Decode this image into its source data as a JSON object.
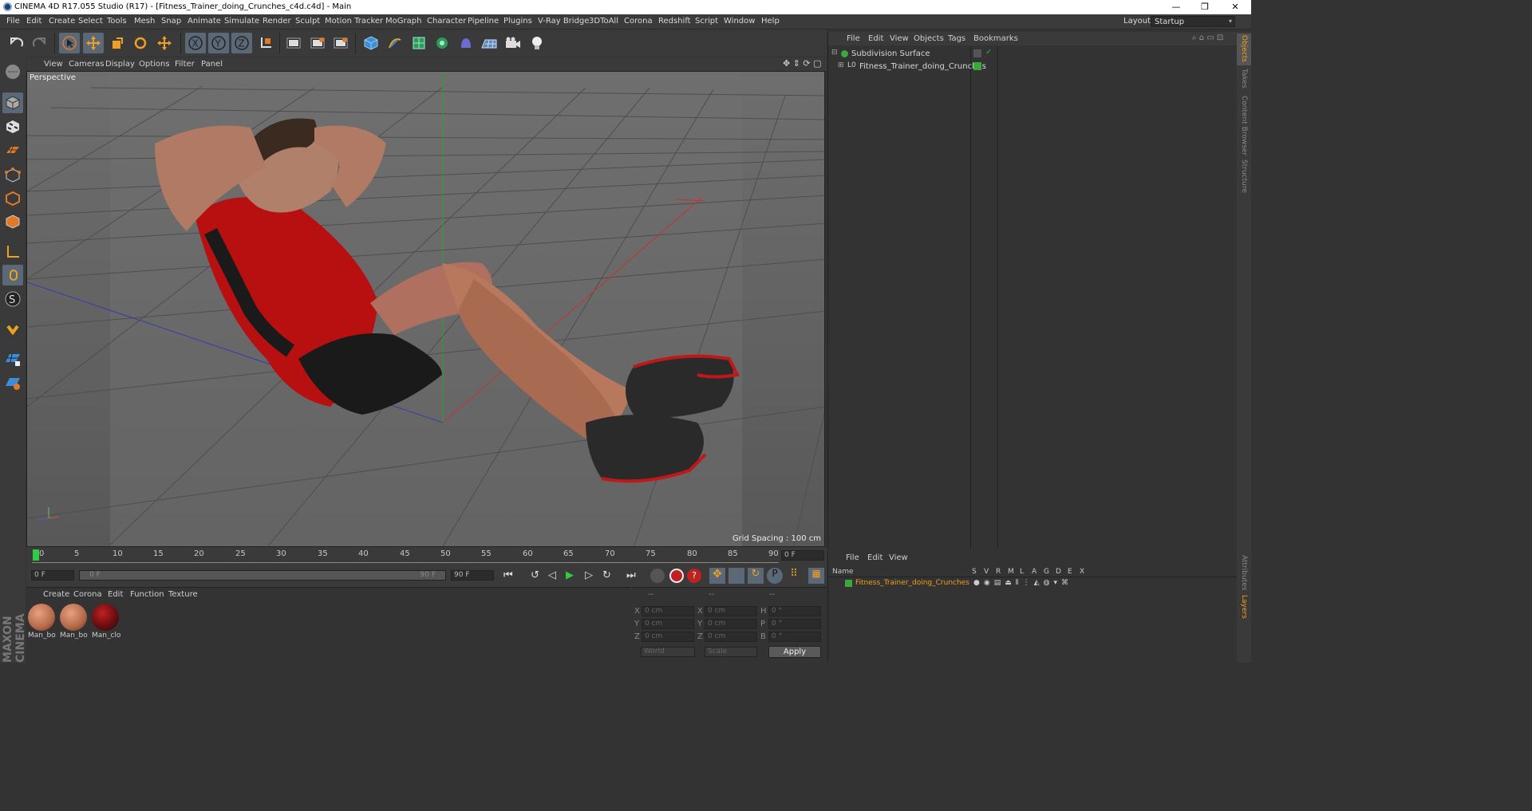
{
  "titlebar": {
    "title": "CINEMA 4D R17.055 Studio (R17) - [Fitness_Trainer_doing_Crunches_c4d.c4d] - Main",
    "minimize": "—",
    "restore": "❐",
    "close": "✕"
  },
  "menubar": {
    "items": [
      "File",
      "Edit",
      "Create",
      "Select",
      "Tools",
      "Mesh",
      "Snap",
      "Animate",
      "Simulate",
      "Render",
      "Sculpt",
      "Motion Tracker",
      "MoGraph",
      "Character",
      "Pipeline",
      "Plugins",
      "V-Ray Bridge",
      "3DToAll",
      "Corona",
      "Redshift",
      "Script",
      "Window",
      "Help"
    ],
    "layout_label": "Layout:",
    "layout_value": "Startup"
  },
  "viewport": {
    "menu": [
      "View",
      "Cameras",
      "Display",
      "Options",
      "Filter",
      "Panel"
    ],
    "camera_label": "Perspective",
    "grid_spacing": "Grid Spacing : 100 cm"
  },
  "timeline": {
    "ticks": [
      "0",
      "5",
      "10",
      "15",
      "20",
      "25",
      "30",
      "35",
      "40",
      "45",
      "50",
      "55",
      "60",
      "65",
      "70",
      "75",
      "80",
      "85",
      "90"
    ],
    "current_frame": "0 F",
    "start_field": "0 F",
    "range_start": "0 F",
    "range_end": "90 F",
    "end_field": "90 F"
  },
  "material_manager": {
    "menu": [
      "Create",
      "Corona",
      "Edit",
      "Function",
      "Texture"
    ],
    "materials": [
      {
        "name": "Man_bo",
        "color": "#b56a4a"
      },
      {
        "name": "Man_bo",
        "color": "#b06848"
      },
      {
        "name": "Man_clo",
        "color": "#6a0d10"
      }
    ]
  },
  "coords": {
    "headers": [
      "--",
      "--",
      "--"
    ],
    "rows": [
      {
        "a": "X",
        "av": "0 cm",
        "b": "X",
        "bv": "0 cm",
        "c": "H",
        "cv": "0 °"
      },
      {
        "a": "Y",
        "av": "0 cm",
        "b": "Y",
        "bv": "0 cm",
        "c": "P",
        "cv": "0 °"
      },
      {
        "a": "Z",
        "av": "0 cm",
        "b": "Z",
        "bv": "0 cm",
        "c": "B",
        "cv": "0 °"
      }
    ],
    "world": "World",
    "scale": "Scale",
    "apply": "Apply"
  },
  "object_manager": {
    "menu": [
      "File",
      "Edit",
      "View",
      "Objects",
      "Tags",
      "Bookmarks"
    ],
    "objects": [
      {
        "name": "Subdivision Surface"
      },
      {
        "name": "Fitness_Trainer_doing_Crunches"
      }
    ]
  },
  "layer_manager": {
    "menu": [
      "File",
      "Edit",
      "View"
    ],
    "col_name": "Name",
    "cols": [
      "S",
      "V",
      "R",
      "M",
      "L",
      "A",
      "G",
      "D",
      "E",
      "X"
    ],
    "layer_name": "Fitness_Trainer_doing_Crunches"
  },
  "right_tabs": [
    "Objects",
    "Takes",
    "Content Browser",
    "Structure"
  ],
  "right_tabs_bottom": [
    "Attributes",
    "Layers"
  ],
  "brand": "MAXON CINEMA 4D",
  "colors": {
    "accent": "#f0a020",
    "layer_green": "#3aa83a",
    "selection": "#5a6878"
  }
}
